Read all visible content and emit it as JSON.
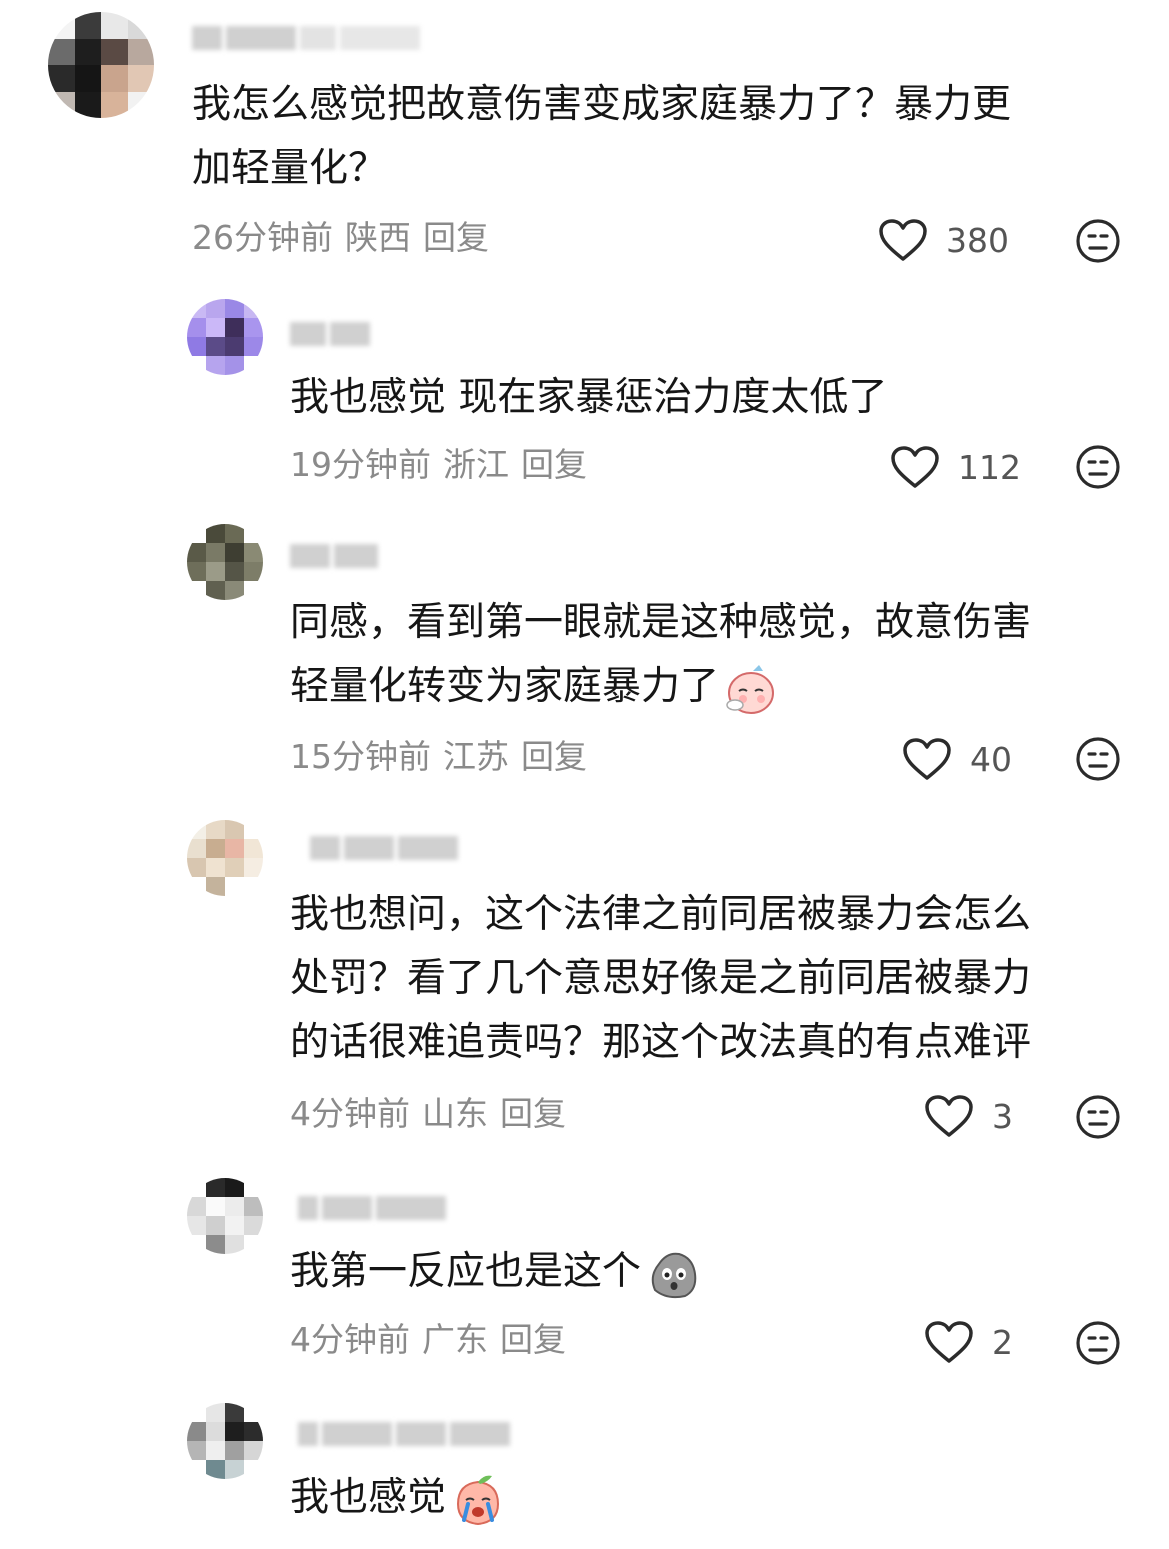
{
  "comments": [
    {
      "text_lines": [
        "我怎么感觉把故意伤害变成家庭暴力了？暴力更",
        "加轻量化？"
      ],
      "time": "26分钟前",
      "location": "陕西",
      "reply": "回复",
      "likes": "380"
    },
    {
      "text_lines": [
        "我也感觉 现在家暴惩治力度太低了"
      ],
      "time": "19分钟前",
      "location": "浙江",
      "reply": "回复",
      "likes": "112"
    },
    {
      "text_lines": [
        "同感，看到第一眼就是这种感觉，故意伤害",
        "轻量化转变为家庭暴力了"
      ],
      "time": "15分钟前",
      "location": "江苏",
      "reply": "回复",
      "likes": "40",
      "emoji": "sighing-face-emoji"
    },
    {
      "text_lines": [
        "我也想问，这个法律之前同居被暴力会怎么",
        "处罚？看了几个意思好像是之前同居被暴力",
        "的话很难追责吗？那这个改法真的有点难评"
      ],
      "time": "4分钟前",
      "location": "山东",
      "reply": "回复",
      "likes": "3"
    },
    {
      "text_lines": [
        "我第一反应也是这个"
      ],
      "time": "4分钟前",
      "location": "广东",
      "reply": "回复",
      "likes": "2",
      "emoji": "shocked-rock-emoji"
    },
    {
      "text_lines": [
        "我也感觉"
      ],
      "emoji": "crying-peach-emoji"
    }
  ],
  "colors": {
    "text": "#161616",
    "meta": "#8a8a8a",
    "icon": "#2b2b2b"
  }
}
